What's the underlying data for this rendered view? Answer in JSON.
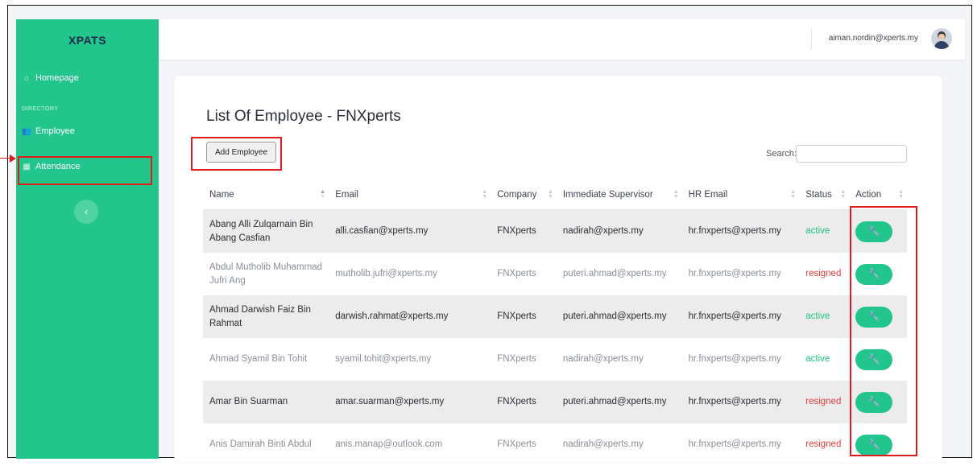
{
  "sidebar": {
    "brand": "XPATS",
    "items": [
      {
        "label": "Homepage",
        "icon": "home-icon"
      },
      {
        "label": "Employee",
        "icon": "users-icon"
      },
      {
        "label": "Attendance",
        "icon": "calendar-icon"
      }
    ],
    "section_heading": "DIRECTORY",
    "collapse_glyph": "‹"
  },
  "header": {
    "user_email": "aiman.nordin@xperts.my"
  },
  "main": {
    "title": "List Of Employee - FNXperts",
    "add_button": "Add Employee",
    "search_label": "Search:",
    "search_value": "",
    "columns": [
      "Name",
      "Email",
      "Company",
      "Immediate Supervisor",
      "HR Email",
      "Status",
      "Action"
    ],
    "rows": [
      {
        "name": "Abang Alli Zulqarnain Bin Abang Casfian",
        "email": "alli.casfian@xperts.my",
        "company": "FNXperts",
        "supervisor": "nadirah@xperts.my",
        "hr_email": "hr.fnxperts@xperts.my",
        "status": "active"
      },
      {
        "name": "Abdul Mutholib Muhammad Jufri Ang",
        "email": "mutholib.jufri@xperts.my",
        "company": "FNXperts",
        "supervisor": "puteri.ahmad@xperts.my",
        "hr_email": "hr.fnxperts@xperts.my",
        "status": "resigned"
      },
      {
        "name": "Ahmad Darwish Faiz Bin Rahmat",
        "email": "darwish.rahmat@xperts.my",
        "company": "FNXperts",
        "supervisor": "puteri.ahmad@xperts.my",
        "hr_email": "hr.fnxperts@xperts.my",
        "status": "active"
      },
      {
        "name": "Ahmad Syamil Bin Tohit",
        "email": "syamil.tohit@xperts.my",
        "company": "FNXperts",
        "supervisor": "nadirah@xperts.my",
        "hr_email": "hr.fnxperts@xperts.my",
        "status": "active"
      },
      {
        "name": "Amar Bin Suarman",
        "email": "amar.suarman@xperts.my",
        "company": "FNXperts",
        "supervisor": "puteri.ahmad@xperts.my",
        "hr_email": "hr.fnxperts@xperts.my",
        "status": "resigned"
      },
      {
        "name": "Anis Damirah Binti Abdul",
        "email": "anis.manap@outlook.com",
        "company": "FNXperts",
        "supervisor": "nadirah@xperts.my",
        "hr_email": "hr.fnxperts@xperts.my",
        "status": "resigned"
      }
    ],
    "action_icon": "wrench-icon"
  },
  "colors": {
    "sidebar_bg": "#22c58b",
    "active_status": "#21c47f",
    "resigned_status": "#e53b3b",
    "annotation_red": "#e01b1b"
  }
}
